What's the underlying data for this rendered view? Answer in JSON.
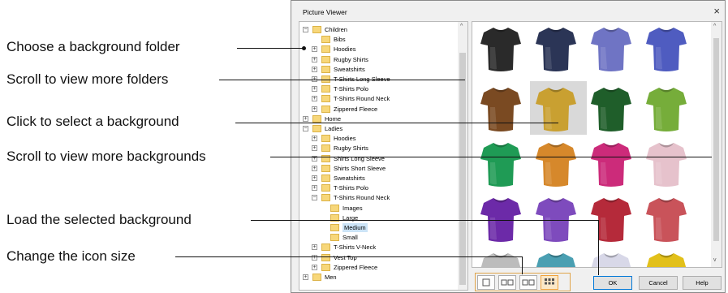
{
  "window": {
    "title": "Picture Viewer",
    "close_glyph": "×"
  },
  "callouts": [
    "Choose a background folder",
    "Scroll to view more folders",
    "Click to select a background",
    "Scroll to view more backgrounds",
    "Load the selected background",
    "Change the icon size"
  ],
  "tree": [
    {
      "label": "Children",
      "depth": 0,
      "exp": "−"
    },
    {
      "label": "Bibs",
      "depth": 1,
      "exp": ""
    },
    {
      "label": "Hoodies",
      "depth": 1,
      "exp": "+"
    },
    {
      "label": "Rugby Shirts",
      "depth": 1,
      "exp": "+"
    },
    {
      "label": "Sweatshirts",
      "depth": 1,
      "exp": "+"
    },
    {
      "label": "T-Shirts Long Sleeve",
      "depth": 1,
      "exp": "+"
    },
    {
      "label": "T-Shirts Polo",
      "depth": 1,
      "exp": "+"
    },
    {
      "label": "T-Shirts Round Neck",
      "depth": 1,
      "exp": "+"
    },
    {
      "label": "Zippered Fleece",
      "depth": 1,
      "exp": "+"
    },
    {
      "label": "Home",
      "depth": 0,
      "exp": "+"
    },
    {
      "label": "Ladies",
      "depth": 0,
      "exp": "−"
    },
    {
      "label": "Hoodies",
      "depth": 1,
      "exp": "+"
    },
    {
      "label": "Rugby Shirts",
      "depth": 1,
      "exp": "+"
    },
    {
      "label": "Shirts Long Sleeve",
      "depth": 1,
      "exp": "+"
    },
    {
      "label": "Shirts Short Sleeve",
      "depth": 1,
      "exp": "+"
    },
    {
      "label": "Sweatshirts",
      "depth": 1,
      "exp": "+"
    },
    {
      "label": "T-Shirts Polo",
      "depth": 1,
      "exp": "+"
    },
    {
      "label": "T-Shirts Round Neck",
      "depth": 1,
      "exp": "−"
    },
    {
      "label": "Images",
      "depth": 2,
      "exp": ""
    },
    {
      "label": "Large",
      "depth": 2,
      "exp": ""
    },
    {
      "label": "Medium",
      "depth": 2,
      "exp": "",
      "selected": true
    },
    {
      "label": "Small",
      "depth": 2,
      "exp": ""
    },
    {
      "label": "T-Shirts V-Neck",
      "depth": 1,
      "exp": "+"
    },
    {
      "label": "Vest Top",
      "depth": 1,
      "exp": "+"
    },
    {
      "label": "Zippered Fleece",
      "depth": 1,
      "exp": "+"
    },
    {
      "label": "Men",
      "depth": 0,
      "exp": "+"
    }
  ],
  "shirt_colors": [
    "#2a2a2a",
    "#2b3556",
    "#6f74c4",
    "#4f5cc0",
    "#7a4a22",
    "#c9a031",
    "#1f5e2a",
    "#76ad3a",
    "#1f9b55",
    "#d6882b",
    "#cc2b7a",
    "#e6c2cc",
    "#6c2aa8",
    "#7e4bbd",
    "#b52a3a",
    "#c9535a",
    "#bcbcbc",
    "#4a9fb2",
    "#d8d8e8",
    "#e2c01a"
  ],
  "selected_shirt": 5,
  "buttons": {
    "ok": "OK",
    "cancel": "Cancel",
    "help": "Help"
  },
  "icon_size_buttons": [
    "icon-size-small",
    "icon-size-medium",
    "icon-size-large",
    "icon-size-extra-large"
  ],
  "scroll_arrows": {
    "up": "^",
    "down": "v"
  }
}
